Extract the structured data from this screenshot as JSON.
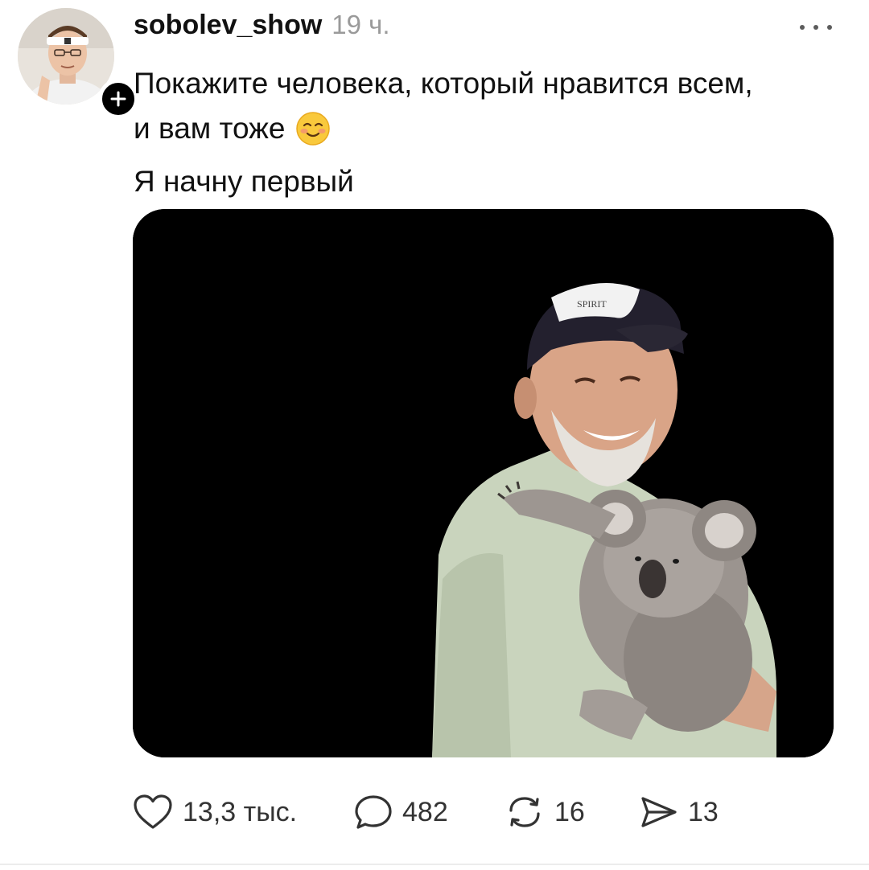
{
  "post": {
    "author": {
      "username": "sobolev_show",
      "avatar_icon": "profile-photo",
      "follow_icon": "plus-icon"
    },
    "timestamp": "19 ч.",
    "more_icon": "ellipsis-icon",
    "text_lines": [
      "Покажите человека, который нравится всем,",
      "и вам тоже",
      "Я начну первый"
    ],
    "emoji": "smiling-face-emoji",
    "media": {
      "type": "photo",
      "background": "#000000",
      "cap_text": "SPIRIT"
    },
    "actions": {
      "like": {
        "icon": "heart-icon",
        "count": "13,3 тыс."
      },
      "comment": {
        "icon": "comment-bubble-icon",
        "count": "482"
      },
      "repost": {
        "icon": "repost-arrows-icon",
        "count": "16"
      },
      "share": {
        "icon": "send-icon",
        "count": "13"
      }
    }
  },
  "colors": {
    "text": "#111111",
    "muted": "#9a9a9a",
    "icon": "#333333"
  }
}
